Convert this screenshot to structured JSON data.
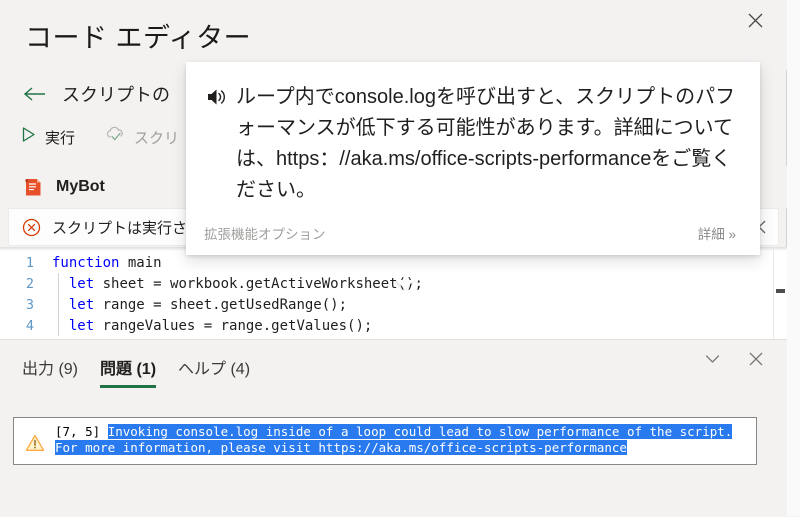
{
  "header": {
    "title": "コード エディター",
    "close_icon": "close-icon"
  },
  "breadcrumb": {
    "back_icon": "arrow-left-icon",
    "label": "スクリプトの"
  },
  "toolbar": {
    "run_label": "実行",
    "run_icon": "play-triangle-icon",
    "save_label": "スクリ",
    "save_icon": "cloud-check-icon",
    "more_icon": "ellipsis-icon"
  },
  "script": {
    "icon": "script-document-icon",
    "name": "MyBot",
    "saved_icon": "checkmark-icon"
  },
  "messagebar": {
    "icon": "error-circle-x-icon",
    "text": "スクリプトは実行さ",
    "close_icon": "close-icon"
  },
  "editor": {
    "lines": [
      {
        "number": "1",
        "code": "function main",
        "keyword": "function"
      },
      {
        "number": "2",
        "code": "  let sheet = workbook.getActiveWorksheet();",
        "keyword": "let"
      },
      {
        "number": "3",
        "code": "  let range = sheet.getUsedRange();",
        "keyword": "let"
      },
      {
        "number": "4",
        "code": "  let rangeValues = range.getValues();",
        "keyword": "let"
      }
    ]
  },
  "console": {
    "tabs": [
      {
        "label": "出力 (9)",
        "active": false
      },
      {
        "label": "問題 (1)",
        "active": true
      },
      {
        "label": "ヘルプ (4)",
        "active": false
      }
    ],
    "collapse_icon": "chevron-down-icon",
    "close_icon": "close-icon",
    "problems": [
      {
        "icon": "warning-triangle-icon",
        "location": "[7, 5]",
        "message": "Invoking console.log inside of a loop could lead to slow performance of the script. For more information, please visit https://aka.ms/office-scripts-performance"
      }
    ]
  },
  "tooltip": {
    "speaker_icon": "speaker-sound-icon",
    "text": "ループ内でconsole.logを呼び出すと、スクリプトのパフォーマンスが低下する可能性があります。詳細については、https：//aka.ms/office-scripts-performanceをご覧ください。",
    "footer_left": "拡張機能オプション",
    "footer_right": "詳細 »"
  },
  "colors": {
    "accent_green": "#217346",
    "error_red": "#d83b01",
    "highlight_blue": "#2979ef",
    "keyword_blue": "#0000ff",
    "linenumber_blue": "#5f97c7",
    "warning_amber": "#ffaa44",
    "pane_bg": "#f3f2f1"
  }
}
